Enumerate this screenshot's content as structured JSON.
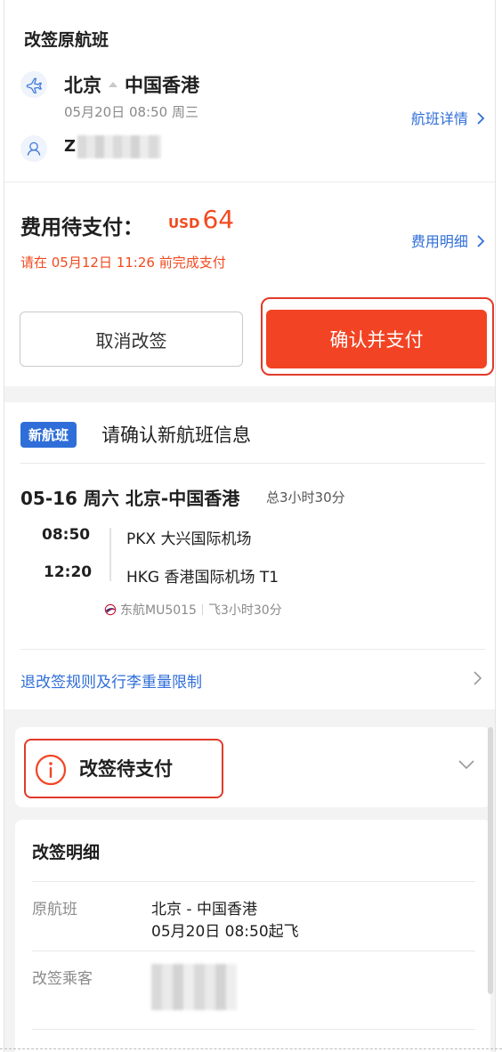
{
  "original_flight": {
    "title": "改签原航班",
    "from": "北京",
    "to": "中国香港",
    "depart": "05月20日 08:50 周三",
    "detail_link": "航班详情",
    "passenger_initial": "Z"
  },
  "payment": {
    "label": "费用待支付：",
    "currency": "USD",
    "amount": "64",
    "fee_link": "费用明细",
    "deadline": "请在 05月12日 11:26 前完成支付",
    "cancel_button": "取消改签",
    "confirm_button": "确认并支付"
  },
  "new_flight": {
    "badge": "新航班",
    "title": "请确认新航班信息",
    "trip_head": "05-16 周六 北京-中国香港",
    "total_duration": "总3小时30分",
    "dep_time": "08:50",
    "arr_time": "12:20",
    "dep_airport": "PKX 大兴国际机场",
    "arr_airport": "HKG 香港国际机场 T1",
    "airline": "东航MU5015",
    "flight_duration": "飞3小时30分",
    "rules_link": "退改签规则及行李重量限制"
  },
  "status": {
    "text": "改签待支付"
  },
  "details": {
    "title": "改签明细",
    "orig_label": "原航班",
    "orig_route": "北京 - 中国香港",
    "orig_time": "05月20日 08:50起飞",
    "pax_label": "改签乘客"
  },
  "colors": {
    "accent_blue": "#2f6ed8",
    "accent_red": "#f24424",
    "highlight_box": "#e23a2a"
  }
}
